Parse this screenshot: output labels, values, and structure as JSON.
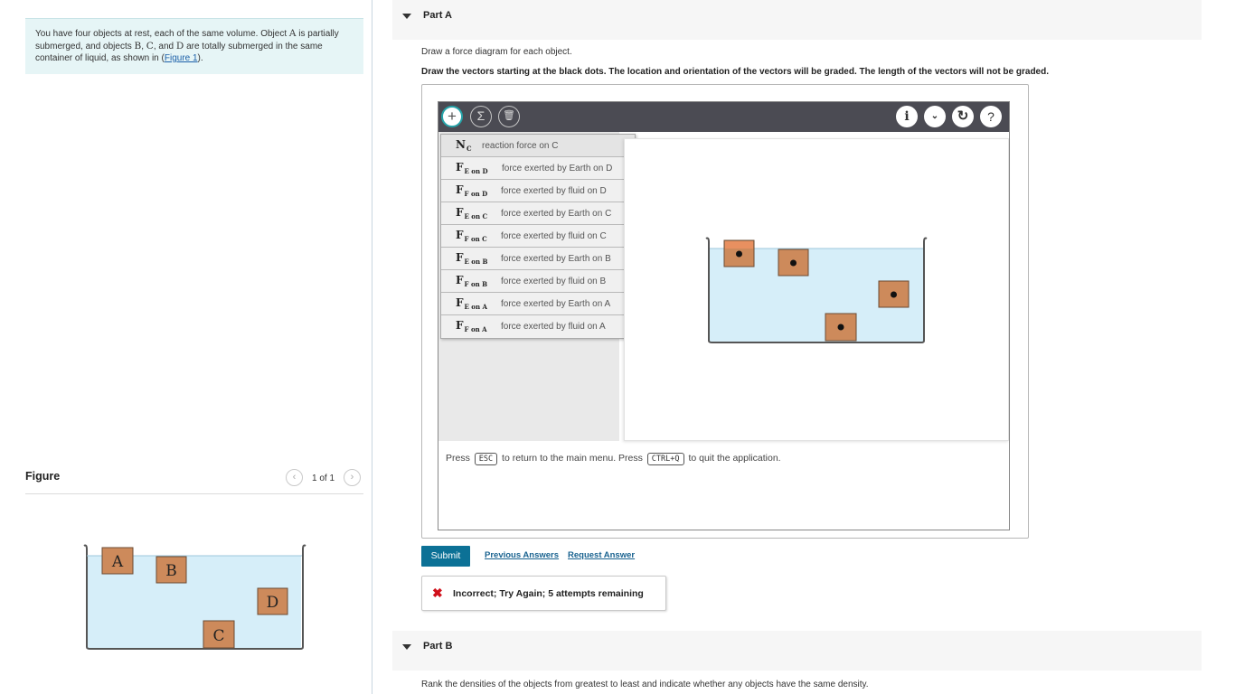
{
  "intro": {
    "text_1": "You have four objects at rest, each of the same volume. Object ",
    "obj_a": "A",
    "text_2": " is partially submerged, and objects ",
    "obj_b": "B",
    "text_3": ", ",
    "obj_c": "C",
    "text_4": ", and ",
    "obj_d": "D",
    "text_5": " are totally submerged in the same container of liquid, as shown in (",
    "figure_link": "Figure 1",
    "text_6": ")."
  },
  "figure": {
    "title": "Figure",
    "page": "1 of 1",
    "labels": {
      "a": "A",
      "b": "B",
      "c": "C",
      "d": "D"
    }
  },
  "partA": {
    "title": "Part A",
    "instruction_1": "Draw a force diagram for each object.",
    "instruction_2": "Draw the vectors starting at the black dots. The location and orientation of the vectors will be graded. The length of the vectors will not be graded."
  },
  "toolbar": {
    "add_icon": "plus-icon",
    "sum_icon": "sigma-icon",
    "trash_icon": "trash-icon",
    "info_icon": "info-icon",
    "down_icon": "chevron-down-icon",
    "reset_icon": "reset-icon",
    "help_icon": "help-icon"
  },
  "menu": [
    {
      "main": "N",
      "sub": "C",
      "desc": "reaction force on C"
    },
    {
      "main": "F",
      "sub": "E on D",
      "desc": "force exerted by Earth on D"
    },
    {
      "main": "F",
      "sub": "F on D",
      "desc": "force exerted by fluid on D"
    },
    {
      "main": "F",
      "sub": "E on C",
      "desc": "force exerted by Earth on C"
    },
    {
      "main": "F",
      "sub": "F on C",
      "desc": "force exerted by fluid on C"
    },
    {
      "main": "F",
      "sub": "E on B",
      "desc": "force exerted by Earth on B"
    },
    {
      "main": "F",
      "sub": "F on B",
      "desc": "force exerted by fluid on B"
    },
    {
      "main": "F",
      "sub": "E on A",
      "desc": "force exerted by Earth on A"
    },
    {
      "main": "F",
      "sub": "F on A",
      "desc": "force exerted by fluid on A"
    }
  ],
  "hint": {
    "press_1": "Press",
    "key_1": "ESC",
    "mid": "to return to the main menu. Press",
    "key_2": "CTRL+Q",
    "end": "to quit the application."
  },
  "actions": {
    "submit": "Submit",
    "previous_answers": "Previous Answers",
    "request_answer": "Request Answer"
  },
  "feedback": {
    "icon": "x-icon",
    "text": "Incorrect; Try Again; 5 attempts remaining"
  },
  "partB": {
    "title": "Part B",
    "instruction": "Rank the densities of the objects from greatest to least and indicate whether any objects have the same density."
  },
  "colors": {
    "accent": "#0c7196",
    "liquid": "#d6eef9",
    "block": "#cd8a5b",
    "block_highlight": "#e89060",
    "toolbar": "#4b4b53",
    "error": "#d0101b"
  }
}
